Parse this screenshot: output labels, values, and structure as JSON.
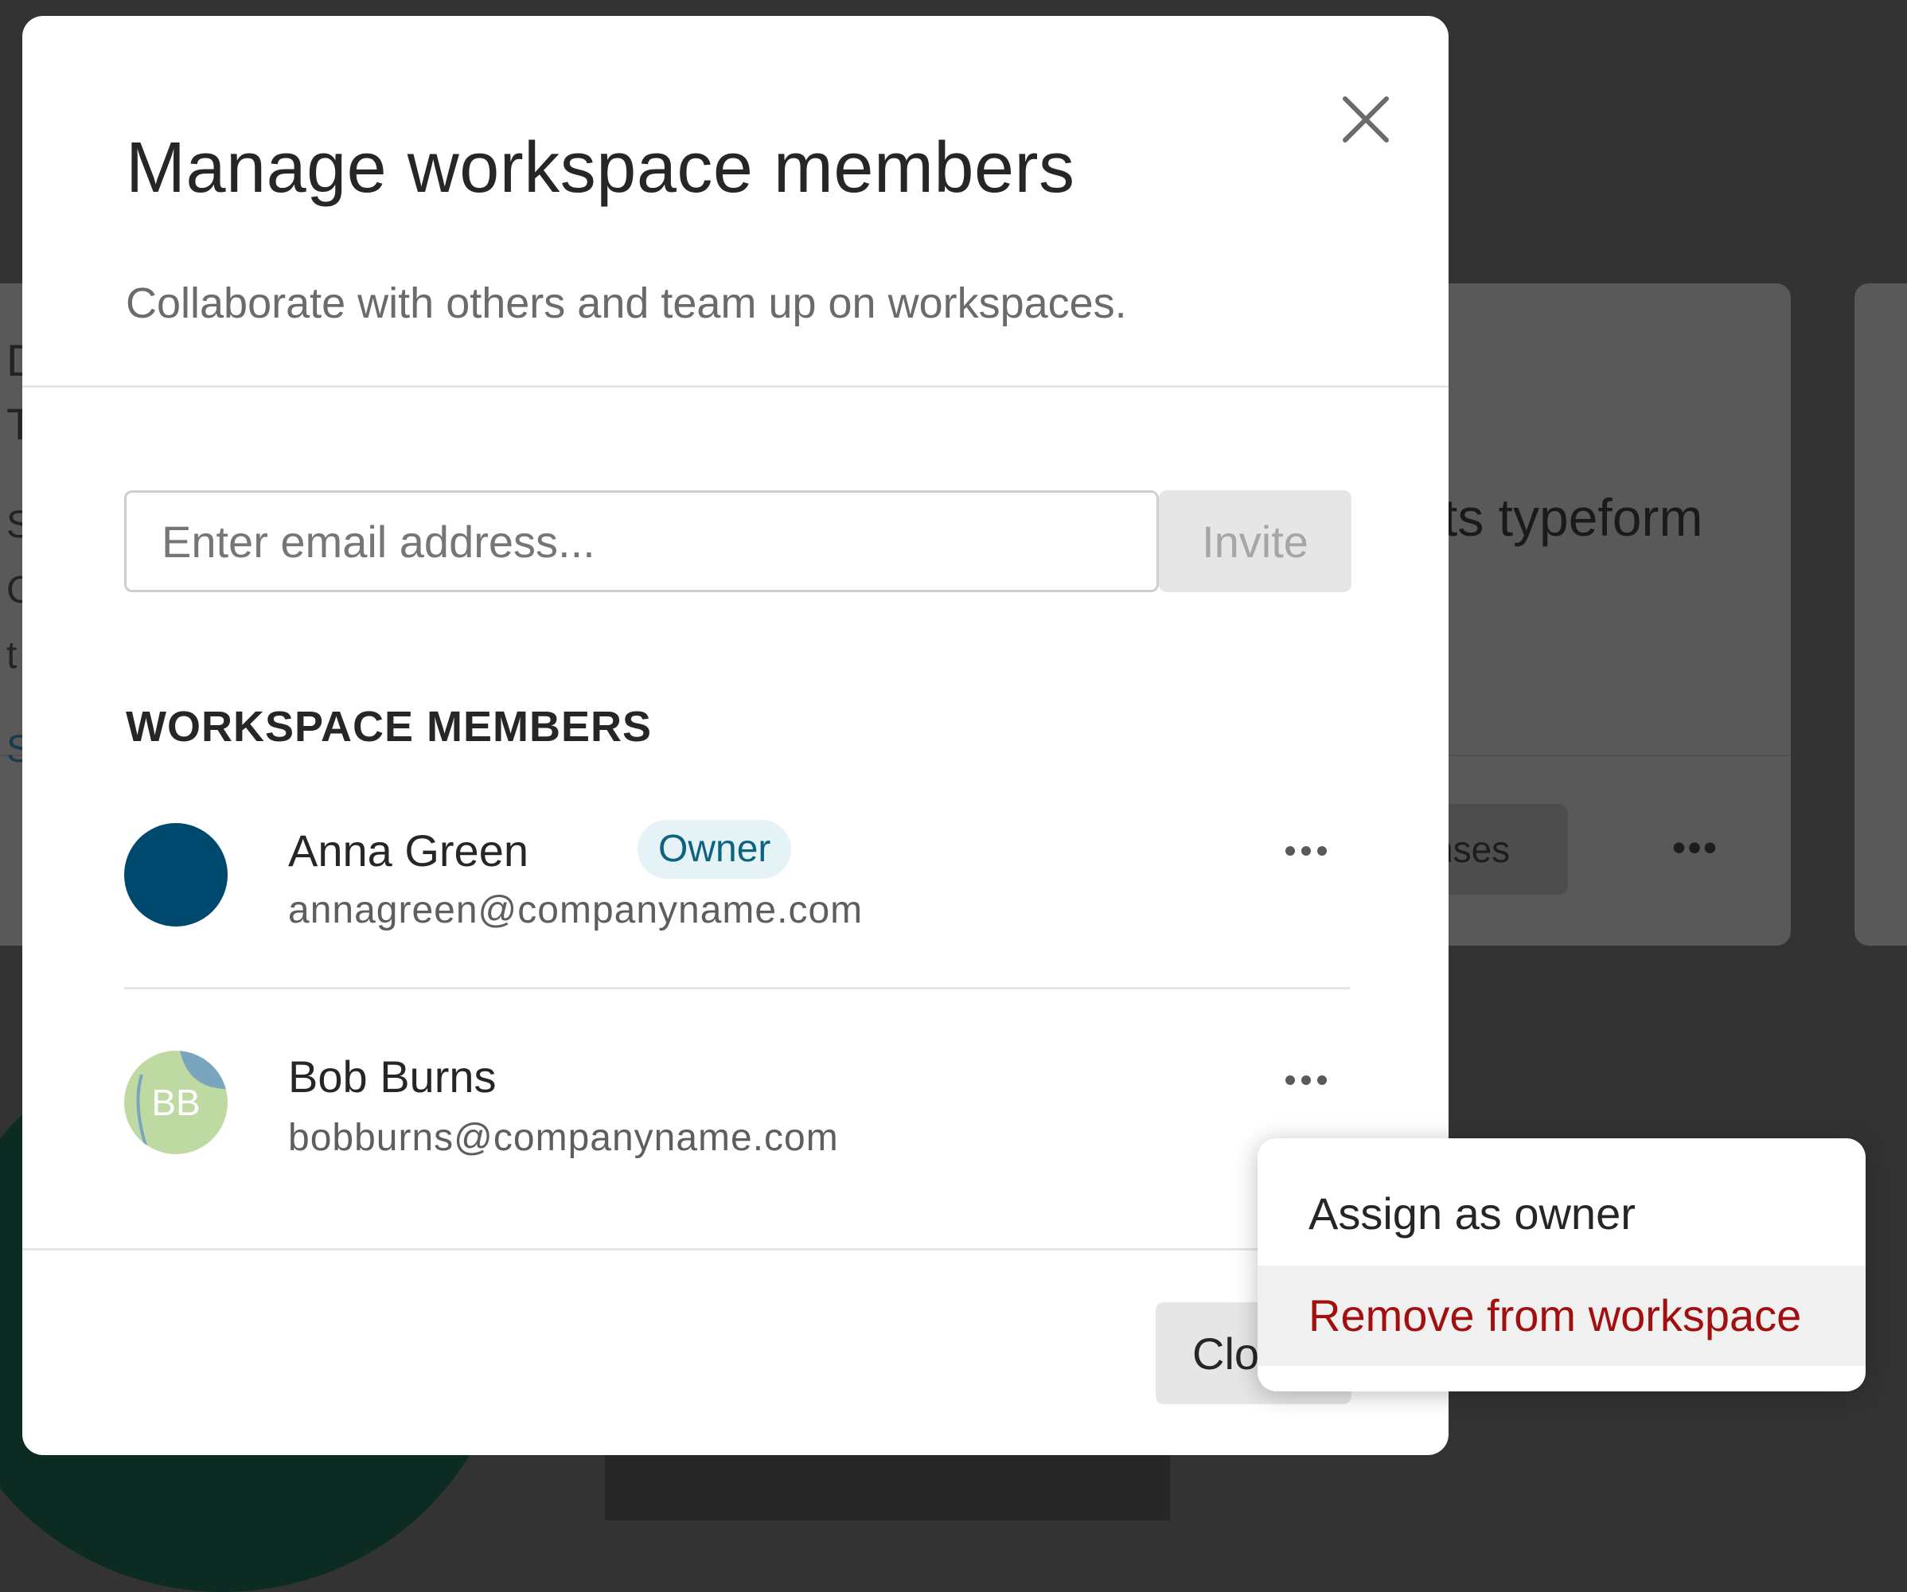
{
  "background": {
    "card_title_fragment": "cts typeform",
    "pill_fragment": "nses",
    "more_glyph": "•••",
    "left_fragments": [
      "D",
      "T",
      "S",
      "C",
      "t",
      "S"
    ]
  },
  "modal": {
    "title": "Manage workspace members",
    "subtitle": "Collaborate with others and team up on workspaces.",
    "close_icon": "close-icon",
    "email_input": {
      "placeholder": "Enter email address...",
      "value": ""
    },
    "invite_label": "Invite",
    "members_heading": "WORKSPACE MEMBERS",
    "members": [
      {
        "name": "Anna Green",
        "email": "annagreen@companyname.com",
        "badge": "Owner",
        "avatar_color": "#00496e"
      },
      {
        "name": "Bob Burns",
        "email": "bobburns@companyname.com",
        "initials": "BB",
        "avatar_color": "#bfd9a3",
        "avatar_accent": "#7aa5bf"
      }
    ],
    "close_label": "Close"
  },
  "context_menu": {
    "items": [
      {
        "label": "Assign as owner"
      },
      {
        "label": "Remove from workspace",
        "color": "#a10f0f"
      }
    ]
  }
}
